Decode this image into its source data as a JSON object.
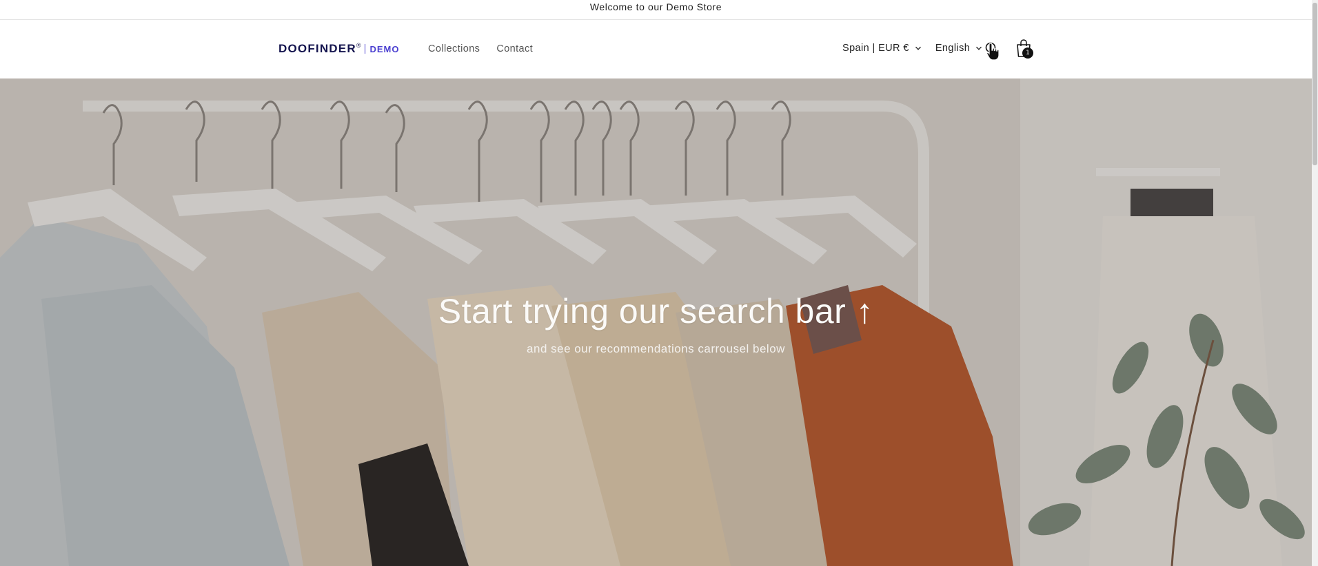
{
  "announcement": {
    "text": "Welcome to our Demo Store"
  },
  "header": {
    "logo": {
      "brand": "DOOFINDER",
      "suffix": "DEMO"
    },
    "nav": [
      {
        "label": "Collections"
      },
      {
        "label": "Contact"
      }
    ],
    "country_selector": {
      "value": "Spain | EUR €"
    },
    "language_selector": {
      "value": "English"
    },
    "search": {
      "icon": "search-icon"
    },
    "cart": {
      "icon": "cart-icon",
      "count": "1"
    }
  },
  "hero": {
    "title": "Start trying our search bar ↑",
    "subtitle": "and see our recommendations carrousel below"
  },
  "colors": {
    "logo_dark": "#14144e",
    "logo_accent": "#4a3fd0",
    "hero_text": "#fbfaf8"
  }
}
